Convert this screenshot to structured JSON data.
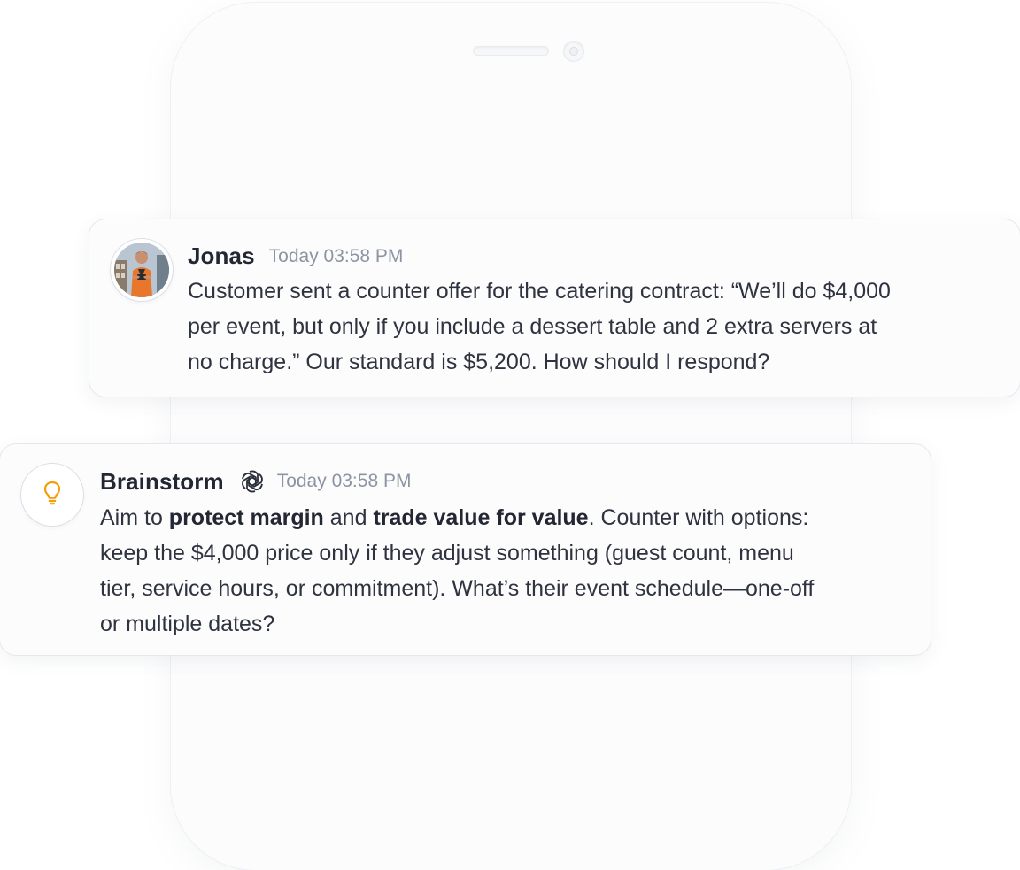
{
  "messages": [
    {
      "sender": "Jonas",
      "timestamp": "Today 03:58 PM",
      "avatar": "user-photo-avatar",
      "lines": [
        "Customer sent a counter offer for the catering contract: “We’ll do $4,000",
        "per event, but only if you include a dessert table and 2 extra servers at",
        "no charge.” Our standard is $5,200. How should I respond?"
      ]
    },
    {
      "sender": "Brainstorm",
      "timestamp": "Today 03:58 PM",
      "avatar": "lightbulb-icon",
      "model_icon": "openai-icon",
      "accent_color": "#f59e0b",
      "line1": {
        "t1": "Aim to ",
        "b1": "protect margin",
        "t2": " and ",
        "b2": "trade value for value",
        "t3": ". Counter with options:"
      },
      "lines_rest": [
        "keep the $4,000 price only if they adjust something (guest count, menu",
        "tier, service hours, or commitment). What’s their event schedule—one-off",
        "or multiple dates?"
      ]
    }
  ]
}
